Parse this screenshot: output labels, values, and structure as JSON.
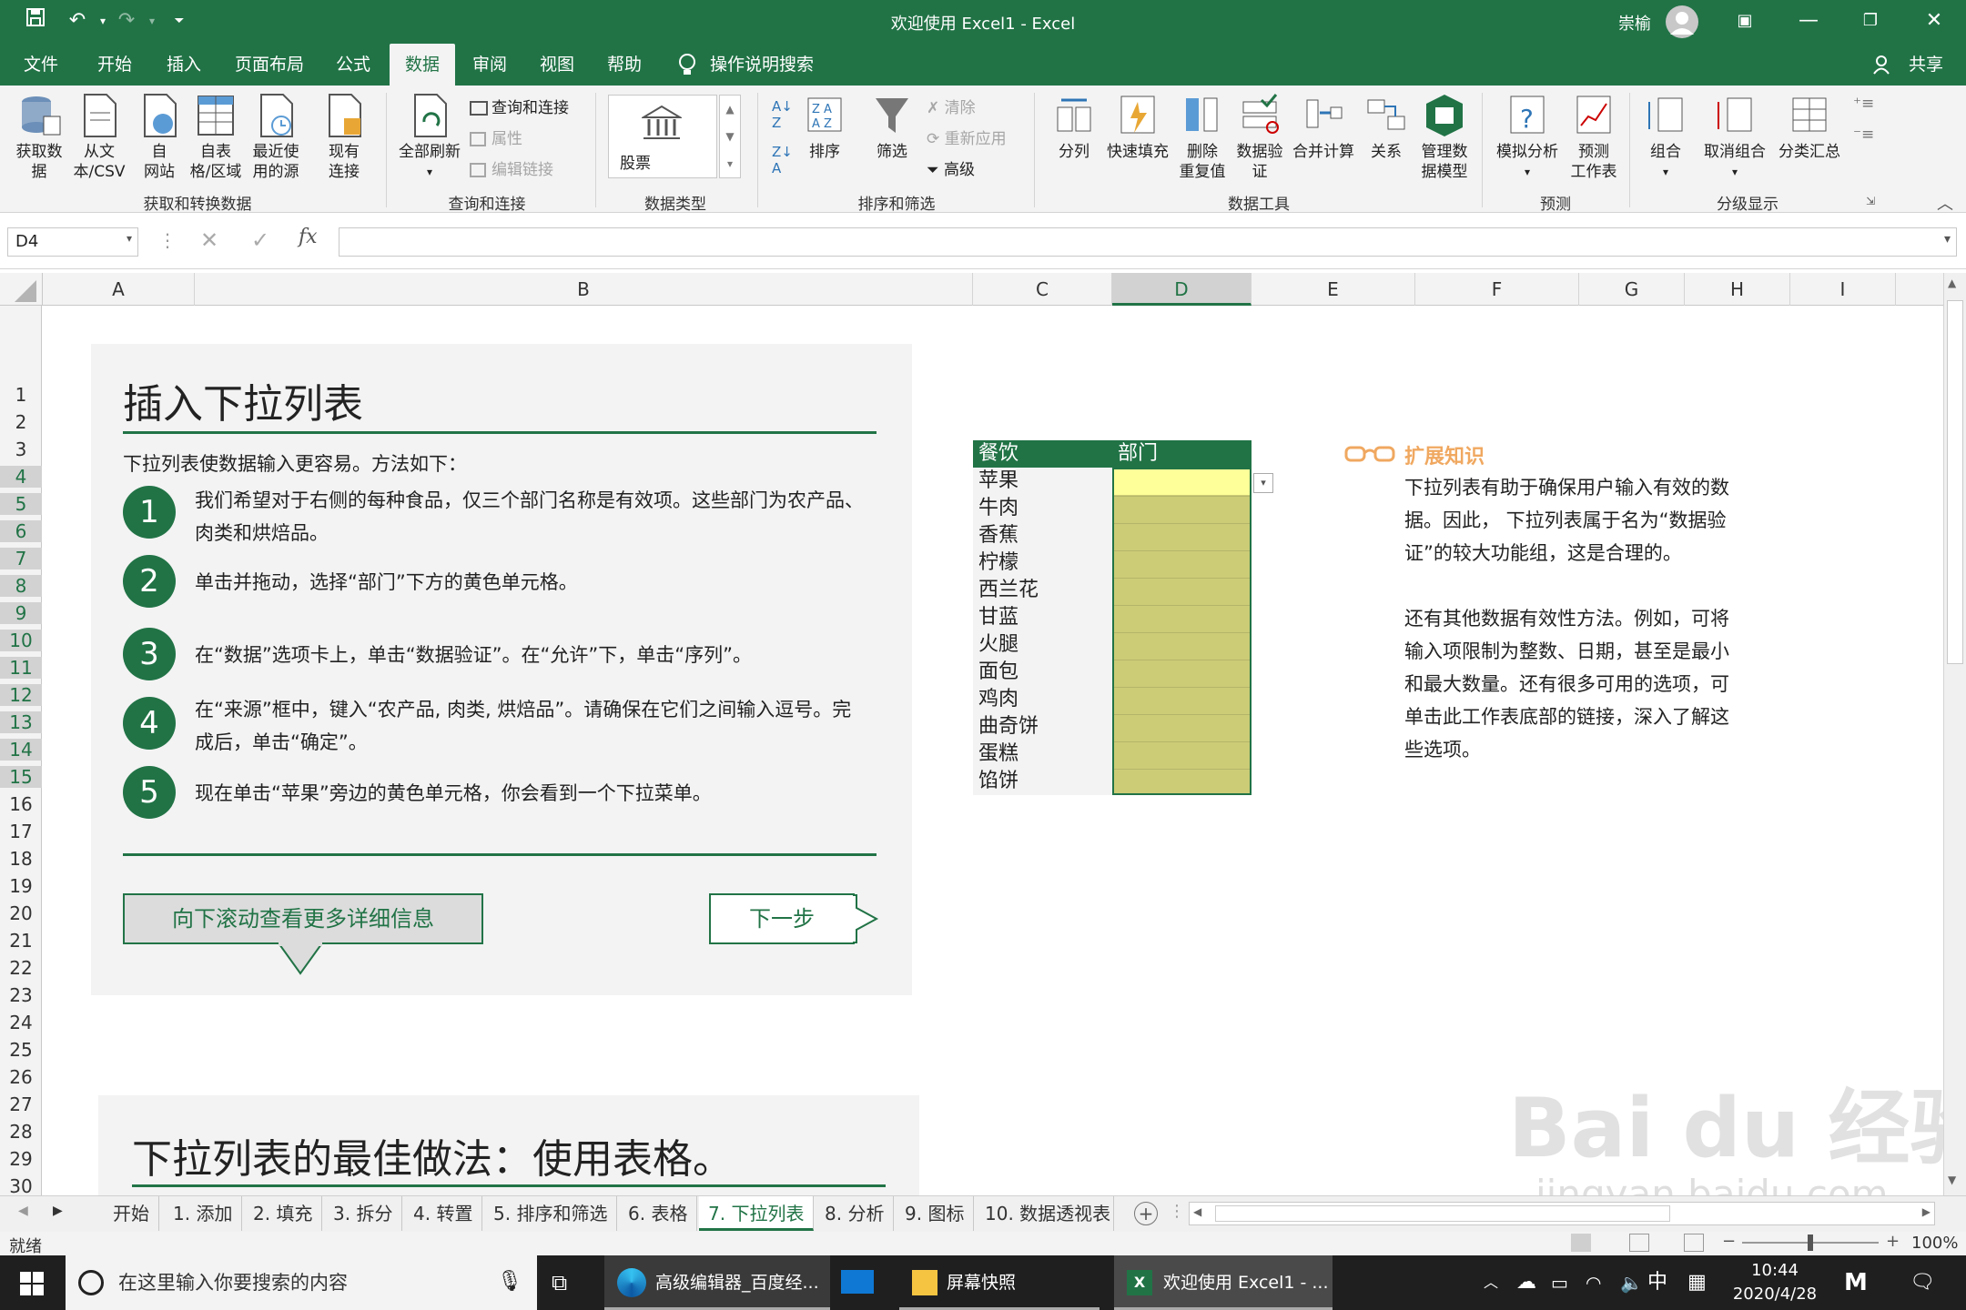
{
  "title_bar": {
    "title": "欢迎使用 Excel1  -  Excel",
    "user": "崇榆"
  },
  "ribbon_tabs": [
    {
      "label": "文件",
      "active": false
    },
    {
      "label": "开始",
      "active": false
    },
    {
      "label": "插入",
      "active": false
    },
    {
      "label": "页面布局",
      "active": false
    },
    {
      "label": "公式",
      "active": false
    },
    {
      "label": "数据",
      "active": true
    },
    {
      "label": "审阅",
      "active": false
    },
    {
      "label": "视图",
      "active": false
    },
    {
      "label": "帮助",
      "active": false
    }
  ],
  "tell_me": "操作说明搜索",
  "share": "共享",
  "ribbon": {
    "get_data": "获取数\n据",
    "from_csv": "从文\n本/CSV",
    "from_web": "自\n网站",
    "from_table": "自表\n格/区域",
    "recent_sources": "最近使\n用的源",
    "existing_conn": "现有\n连接",
    "group_get": "获取和转换数据",
    "refresh_all": "全部刷新",
    "queries_conn": "查询和连接",
    "properties": "属性",
    "edit_links": "编辑链接",
    "group_queries": "查询和连接",
    "stocks": "股票",
    "group_datatype": "数据类型",
    "sort": "排序",
    "filter": "筛选",
    "clear": "清除",
    "reapply": "重新应用",
    "advanced": "高级",
    "group_sort": "排序和筛选",
    "text_to_cols": "分列",
    "flash_fill": "快速填充",
    "remove_dup": "删除\n重复值",
    "validation": "数据验\n证",
    "consolidate": "合并计算",
    "relationships": "关系",
    "data_model": "管理数\n据模型",
    "group_tools": "数据工具",
    "what_if": "模拟分析",
    "forecast": "预测\n工作表",
    "group_forecast": "预测",
    "group_btn": "组合",
    "ungroup": "取消组合",
    "subtotal": "分类汇总",
    "group_outline": "分级显示"
  },
  "name_box": "D4",
  "formula": "",
  "columns": [
    "A",
    "B",
    "C",
    "D",
    "E",
    "F",
    "G",
    "H",
    "I"
  ],
  "rows": [
    "1",
    "2",
    "3",
    "4",
    "5",
    "6",
    "7",
    "8",
    "9",
    "10",
    "11",
    "12",
    "13",
    "14",
    "15",
    "16",
    "17",
    "18",
    "19",
    "20",
    "21",
    "22",
    "23",
    "24",
    "25",
    "26",
    "27",
    "28",
    "29",
    "30"
  ],
  "card1": {
    "title": "插入下拉列表",
    "intro": "下拉列表使数据输入更容易。方法如下：",
    "steps": [
      {
        "n": "1",
        "text": "我们希望对于右侧的每种食品，仅三个部门名称是有效项。这些部门为农产品、肉类和烘焙品。"
      },
      {
        "n": "2",
        "text": "单击并拖动，选择“部门”下方的黄色单元格。"
      },
      {
        "n": "3",
        "text": "在“数据”选项卡上，单击“数据验证”。在“允许”下，单击“序列”。"
      },
      {
        "n": "4",
        "text": "在“来源”框中，键入“农产品, 肉类, 烘焙品”。请确保在它们之间输入逗号。完成后，单击“确定”。"
      },
      {
        "n": "5",
        "text": "现在单击“苹果”旁边的黄色单元格，你会看到一个下拉菜单。"
      }
    ],
    "scroll_btn": "向下滚动查看更多详细信息",
    "next_btn": "下一步"
  },
  "table": {
    "header_food": "餐饮",
    "header_dept": "部门",
    "foods": [
      "苹果",
      "牛肉",
      "香蕉",
      "柠檬",
      "西兰花",
      "甘蓝",
      "火腿",
      "面包",
      "鸡肉",
      "曲奇饼",
      "蛋糕",
      "馅饼"
    ]
  },
  "extend": {
    "title": "扩展知识",
    "p1": "下拉列表有助于确保用户输入有效的数据。因此， 下拉列表属于名为“数据验证”的较大功能组，这是合理的。",
    "p2": "还有其他数据有效性方法。例如，可将输入项限制为整数、日期，甚至是最小和最大数量。还有很多可用的选项，可单击此工作表底部的链接，深入了解这些选项。"
  },
  "card2_title": "下拉列表的最佳做法：使用表格。",
  "sheet_tabs": [
    "开始",
    "1. 添加",
    "2. 填充",
    "3. 拆分",
    "4. 转置",
    "5. 排序和筛选",
    "6. 表格",
    "7. 下拉列表",
    "8. 分析",
    "9. 图标",
    "10. 数据透视表 ..."
  ],
  "active_sheet": "7. 下拉列表",
  "status": {
    "ready": "就绪",
    "zoom": "100%"
  },
  "taskbar": {
    "search": "在这里输入你要搜索的内容",
    "apps": [
      "高级编辑器_百度经...",
      "屏幕快照",
      "欢迎使用 Excel1 - ..."
    ],
    "time": "10:44",
    "date": "2020/4/28",
    "ime": "中"
  },
  "watermark": "Bai du 经验\njingyan.baidu.com",
  "colors": {
    "accent": "#217346",
    "yellow_cell": "#cccc77"
  }
}
